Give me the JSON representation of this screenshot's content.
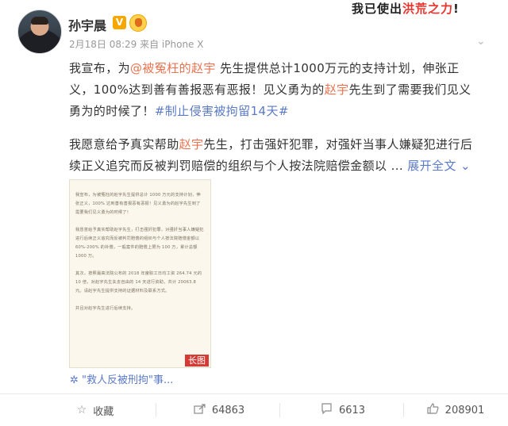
{
  "post": {
    "author": "孙宇晨",
    "verified_badge": "V",
    "meta": "2月18日 08:29 来自 iPhone X",
    "sticker": {
      "prefix": "我已使出",
      "highlight": "洪荒之力",
      "suffix": "!"
    },
    "paragraph1": {
      "t1": "我宣布，为",
      "mention": "@被冤枉的赵宇",
      "t2": " 先生提供总计1000万元的支持计划，伸张正义，100%达到善有善报恶有恶报！见义勇为的",
      "name_link": "赵宇",
      "t3": "先生到了需要我们见义勇为的时候了！",
      "hashtag": "#制止侵害被拘留14天#"
    },
    "paragraph2": {
      "t1": "我愿意给予真实帮助",
      "name_link": "赵宇",
      "t2": "先生，打击强奸犯罪，对强奸当事人嫌疑犯进行后续正义追究而反被判罚赔偿的组织与个人按法院赔偿金额以 ... ",
      "expand": "展开全文",
      "expand_icon": "chevron-down"
    },
    "image": {
      "text": "我宣布，为被冤枉的赵宇先生提供总计 1000 万元的支持计划，伸张正义，100% 达到善有善报恶有恶报！见义勇为的赵宇先生到了需要我们见义勇为的时候了！\n\n我愿意给予真实帮助赵宇先生，打击强奸犯罪，对强奸当事人嫌疑犯进行后续正义追究而反被判罚赔偿的组织与个人按法院赔偿金额以 60%-200% 的补偿，一般案件的赔偿上限为 100 万，累计总额 1000 万。\n\n其次，按照最高法院公布的 2018 年度职工日均工资 264.74 元的 10 倍，对赵宇先生失去自由的 14 天进行资助，共计 20063.8 元。请赵宇先生提供支持的证据材料及联系方式。\n\n并且对赵宇先生进行后续支持。",
      "long_label": "长图"
    },
    "topic": "\"救人反被刑拘\"事..."
  },
  "actions": {
    "favorite": "收藏",
    "share_count": "64863",
    "comment_count": "6613",
    "like_count": "208901"
  },
  "colors": {
    "link": "#eb7350",
    "topic": "#5b7ac7",
    "badge": "#f7a700"
  }
}
